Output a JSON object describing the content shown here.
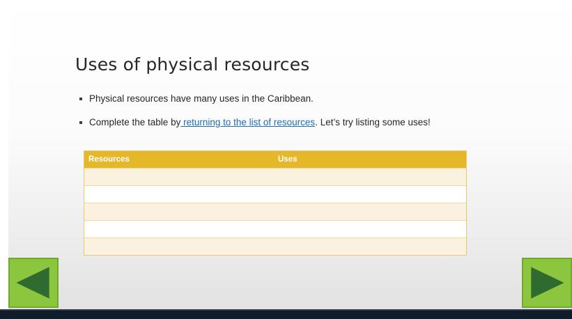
{
  "slide": {
    "title": "Uses of physical resources",
    "bullets": {
      "first": "Physical resources have many uses in the Caribbean.",
      "second_before": "Complete the table by",
      "second_link": " returning to the list of resources",
      "second_after": ". Let’s try listing some uses!"
    }
  },
  "table": {
    "headers": [
      "Resources",
      "Uses"
    ],
    "rows": [
      [
        "",
        ""
      ],
      [
        "",
        ""
      ],
      [
        "",
        ""
      ],
      [
        "",
        ""
      ],
      [
        "",
        ""
      ]
    ]
  },
  "navigation": {
    "prev_icon": "triangle-left-icon",
    "next_icon": "triangle-right-icon"
  },
  "colors": {
    "table_header": "#e5b82a",
    "table_row_alt": "#fbf1df",
    "nav_button": "#8cc63f",
    "nav_arrow": "#2f6b2f",
    "link": "#1f6bb5",
    "footer": "#111c2b"
  }
}
